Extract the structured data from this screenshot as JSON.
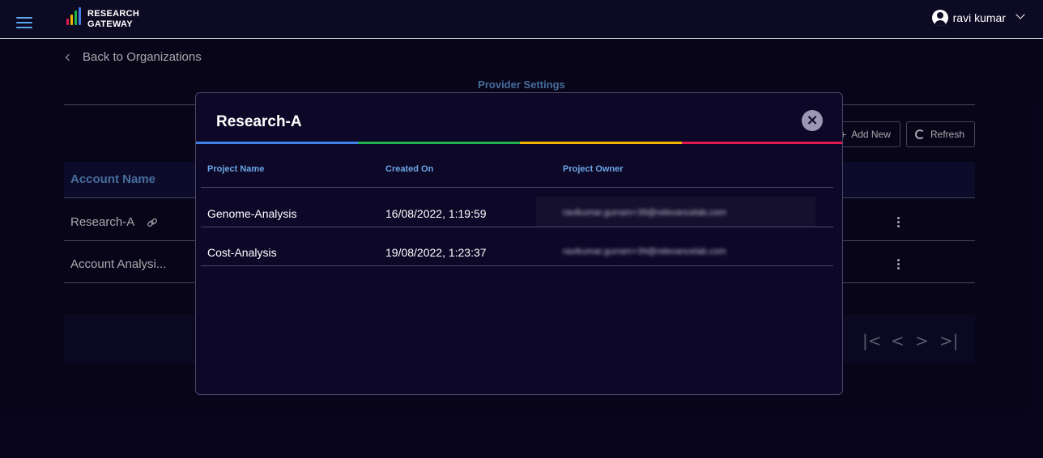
{
  "header": {
    "logo_line1": "RESEARCH",
    "logo_line2": "GATEWAY",
    "user_name": "ravi kumar"
  },
  "page": {
    "back_label": "Back to Organizations",
    "title": "Provider Settings",
    "add_new_label": "Add New",
    "refresh_label": "Refresh"
  },
  "table": {
    "column_account_name": "Account Name",
    "rows": [
      {
        "name": "Research-A"
      },
      {
        "name": "Account Analysi..."
      }
    ]
  },
  "modal": {
    "title": "Research-A",
    "columns": [
      "Project Name",
      "Created On",
      "Project Owner"
    ],
    "rows": [
      {
        "project": "Genome-Analysis",
        "created": "16/08/2022, 1:19:59",
        "owner": "ravikumar.gurram+39@relevancelab.com"
      },
      {
        "project": "Cost-Analysis",
        "created": "19/08/2022, 1:23:37",
        "owner": "ravikumar.gurram+39@relevancelab.com"
      }
    ]
  },
  "colors": {
    "background": "#0b0720",
    "accent_blue": "#6aa6e6",
    "rainbow": [
      "#3f7fe6",
      "#22b24c",
      "#f2b600",
      "#e3174f"
    ]
  }
}
